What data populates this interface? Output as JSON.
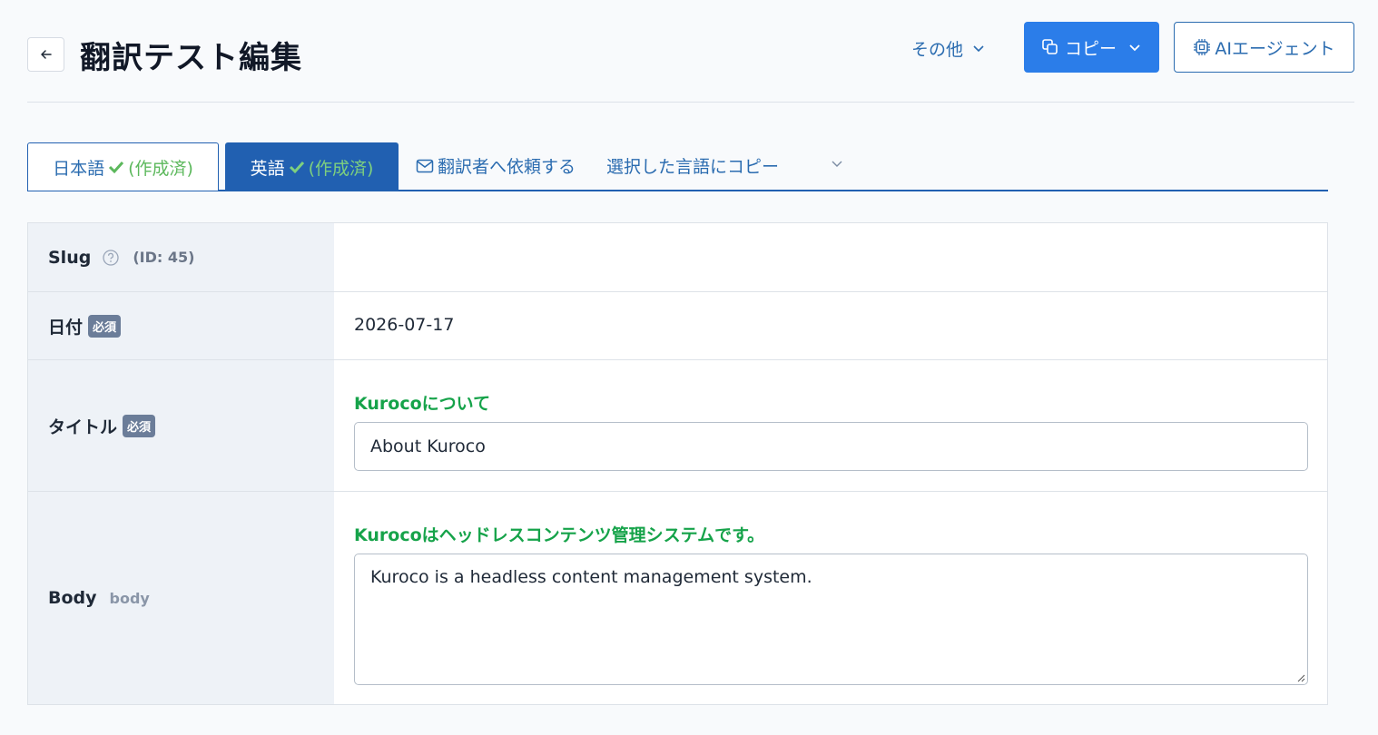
{
  "header": {
    "title": "翻訳テスト編集",
    "more_label": "その他",
    "copy_label": "コピー",
    "ai_label": "AIエージェント"
  },
  "tabs": [
    {
      "label": "日本語",
      "status": "(作成済)"
    },
    {
      "label": "英語",
      "status": "(作成済)"
    }
  ],
  "tab_links": {
    "request": "翻訳者へ依頼する",
    "copy_lang": "選択した言語にコピー"
  },
  "fields": {
    "slug": {
      "label": "Slug",
      "id_text": "(ID: 45)"
    },
    "date": {
      "label": "日付",
      "badge": "必須",
      "value": "2026-07-17"
    },
    "title": {
      "label": "タイトル",
      "badge": "必須",
      "reference": "Kurocoについて",
      "value": "About Kuroco"
    },
    "body": {
      "label": "Body",
      "key": "body",
      "reference": "Kurocoはヘッドレスコンテンツ管理システムです。",
      "value": "Kuroco is a headless content management system."
    }
  },
  "colors": {
    "primary": "#2b7de9",
    "tab_active": "#2160b1",
    "reference_green": "#16a34a",
    "status_green": "#5cb85c",
    "badge": "#6b7d99"
  }
}
